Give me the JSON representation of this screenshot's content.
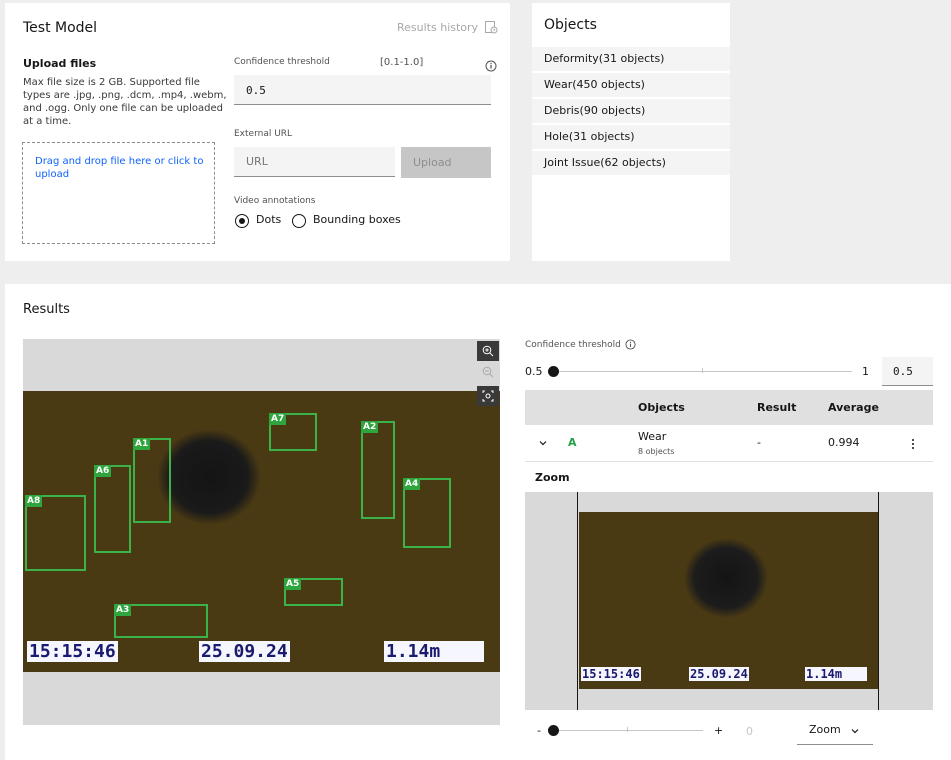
{
  "test_model": {
    "title": "Test Model",
    "results_history": "Results history",
    "upload": {
      "heading": "Upload files",
      "description_lines": [
        "Max file size is 2 GB. Supported file",
        "types are .jpg, .png, .dcm, .mp4, .webm,",
        "and .ogg. Only one file can be uploaded",
        "at a time."
      ],
      "dropzone_lines": [
        "Drag and drop file here or click to",
        "upload"
      ]
    },
    "confidence": {
      "label": "Confidence threshold",
      "range": "[0.1-1.0]",
      "value": "0.5"
    },
    "external_url": {
      "label": "External URL",
      "placeholder": "URL",
      "upload_button": "Upload"
    },
    "video_annotations": {
      "label": "Video annotations",
      "options": [
        "Dots",
        "Bounding boxes"
      ],
      "selected": "Dots"
    }
  },
  "objects_panel": {
    "title": "Objects",
    "items": [
      "Deformity(31 objects)",
      "Wear(450 objects)",
      "Debris(90 objects)",
      "Hole(31 objects)",
      "Joint Issue(62 objects)"
    ]
  },
  "results": {
    "title": "Results",
    "image": {
      "boxes": [
        "A1",
        "A2",
        "A3",
        "A4",
        "A5",
        "A6",
        "A7",
        "A8"
      ],
      "osd_time": "15:15:46",
      "osd_date": "25.09.24",
      "osd_distance": "1.14m"
    },
    "confidence": {
      "label": "Confidence threshold",
      "min": "0.5",
      "max": "1",
      "value": "0.5",
      "level": 0.0
    },
    "table": {
      "headers": [
        "Objects",
        "Result",
        "Average"
      ],
      "row": {
        "tag": "A",
        "object": "Wear",
        "count": "8 objects",
        "result": "-",
        "average": "0.994"
      }
    },
    "zoom": {
      "label": "Zoom",
      "minus": "-",
      "plus": "+",
      "value": "0",
      "dropdown": "Zoom",
      "level": 0.0,
      "osd_time": "15:15:46",
      "osd_date": "25.09.24",
      "osd_distance": "1.14m"
    }
  },
  "colors": {
    "link": "#0f62fe",
    "box_green": "#3bb34a",
    "tag_green": "#24a148"
  },
  "icons": [
    "results-history-icon",
    "info-icon",
    "zoom-in-icon",
    "zoom-out-icon",
    "fit-screen-icon",
    "chevron-down-icon",
    "overflow-menu-icon"
  ]
}
